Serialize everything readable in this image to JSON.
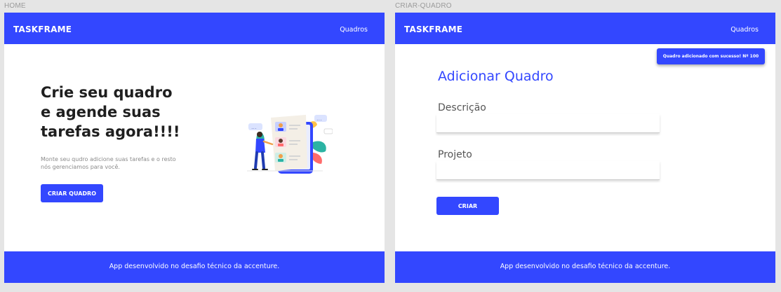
{
  "artboards": {
    "home_label": "HOME",
    "criar_label": "CRIAR-QUADRO"
  },
  "header": {
    "brand": "TASKFRAME",
    "nav_link": "Quadros"
  },
  "home": {
    "title_line1": "Crie seu quadro",
    "title_line2": "e agende suas",
    "title_line3": "tarefas agora!!!!",
    "subtitle_line1": "Monte seu qudro adicione suas tarefas e o resto",
    "subtitle_line2": "nós gerenciamos para você.",
    "cta_label": "CRIAR QUADRO"
  },
  "criar": {
    "toast": "Quadro adicionado com sucesso! Nº 100",
    "form_title": "Adicionar Quadro",
    "descricao_label": "Descrição",
    "descricao_value": "",
    "projeto_label": "Projeto",
    "projeto_value": "",
    "submit_label": "CRIAR"
  },
  "footer": {
    "text": "App desenvolvido no desafio técnico da accenture."
  },
  "colors": {
    "primary": "#3347ff",
    "background": "#e5e5e5"
  }
}
